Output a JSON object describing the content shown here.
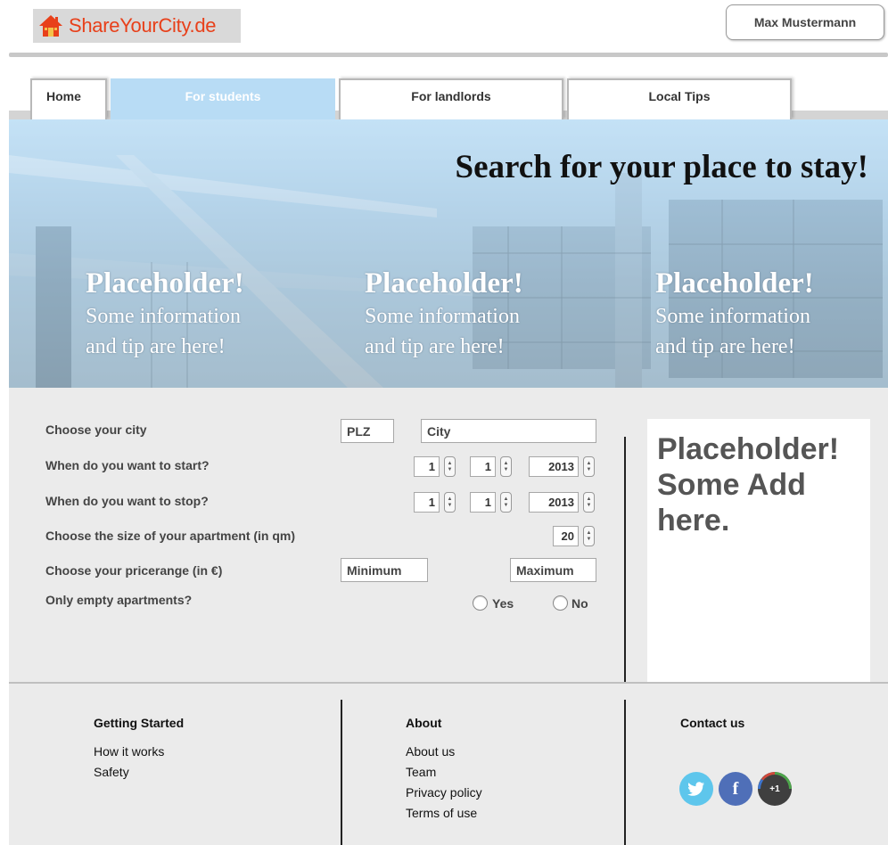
{
  "header": {
    "logo_text": "ShareYourCity.de",
    "user_name": "Max Mustermann"
  },
  "nav": {
    "tabs": [
      {
        "label": "Home"
      },
      {
        "label": "For students",
        "active": true
      },
      {
        "label": "For landlords"
      },
      {
        "label": "Local Tips"
      }
    ]
  },
  "hero": {
    "title": "Search for your place to stay!",
    "placeholders": [
      {
        "title": "Placeholder!",
        "line1": "Some information",
        "line2": "and tip are here!"
      },
      {
        "title": "Placeholder!",
        "line1": "Some information",
        "line2": "and tip are here!"
      },
      {
        "title": "Placeholder!",
        "line1": "Some information",
        "line2": "and tip are here!"
      }
    ]
  },
  "search_form": {
    "city_label": "Choose your city",
    "plz_placeholder": "PLZ",
    "city_placeholder": "City",
    "start_label": "When do you want to start?",
    "start": {
      "day": "1",
      "month": "1",
      "year": "2013"
    },
    "stop_label": "When do you want to stop?",
    "stop": {
      "day": "1",
      "month": "1",
      "year": "2013"
    },
    "size_label": "Choose the size of your apartment (in qm)",
    "size_value": "20",
    "price_label": "Choose your pricerange (in €)",
    "price_min_placeholder": "Minimum",
    "price_max_placeholder": "Maximum",
    "empty_label": "Only empty apartments?",
    "yes_label": "Yes",
    "no_label": "No"
  },
  "ad": {
    "line1": "Placeholder!",
    "line2": "Some Add",
    "line3": "here."
  },
  "footer": {
    "getting_started": {
      "heading": "Getting Started",
      "links": [
        "How it works",
        "Safety"
      ]
    },
    "about": {
      "heading": "About",
      "links": [
        "About us",
        "Team",
        "Privacy policy",
        "Terms of use"
      ]
    },
    "contact": {
      "heading": "Contact us",
      "gplus_label": "+1"
    }
  },
  "colors": {
    "brand": "#e8401a",
    "active_tab": "#b8dcf5",
    "twitter": "#5ec6ec",
    "facebook": "#4f6fb8",
    "gplus": "#3f3f3f"
  },
  "icons": {
    "logo": "house-icon",
    "twitter": "twitter-bird-icon",
    "facebook": "facebook-f-icon",
    "gplus": "google-plus-one-icon",
    "spinner": "up-down-arrows-icon"
  }
}
